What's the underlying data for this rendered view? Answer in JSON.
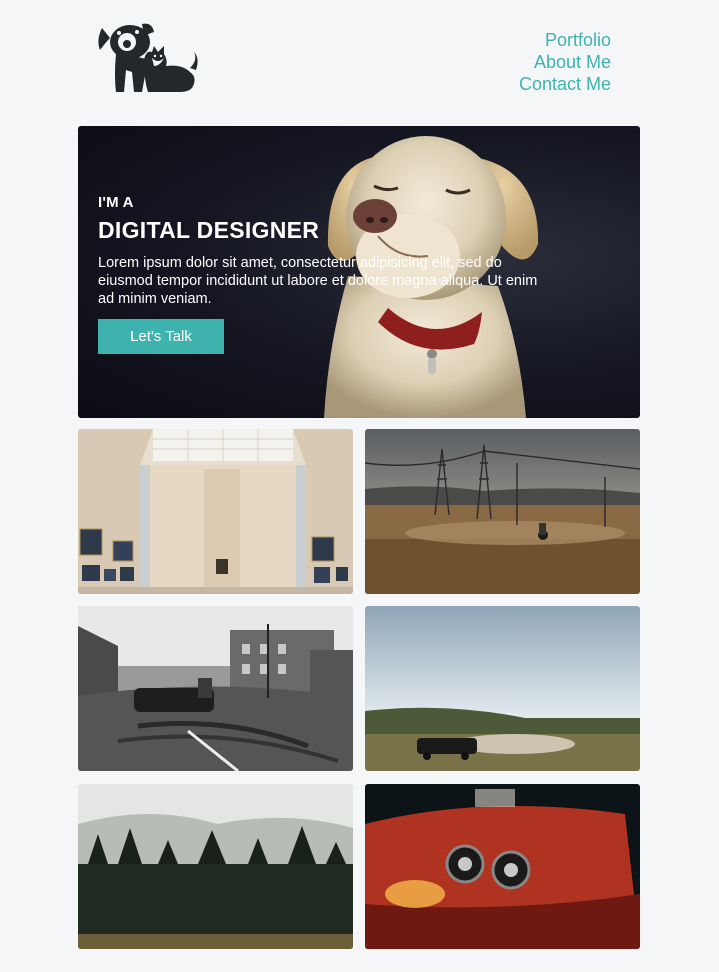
{
  "header": {
    "logo_icon": "dog-and-cat-logo",
    "nav": [
      "Portfolio",
      "About Me",
      "Contact Me"
    ]
  },
  "hero": {
    "kicker": "I'M A",
    "headline": "DIGITAL DESIGNER",
    "description": "Lorem ipsum dolor sit amet, consectetur adipisicing elit, sed do eiusmod tempor incididunt ut labore et dolore magna aliqua. Ut enim ad minim veniam.",
    "cta_label": "Let's Talk",
    "image": "labrador-dog-photo"
  },
  "gallery": [
    "museum-gallery-photo",
    "motorcycle-power-lines-photo",
    "street-drift-bw-photo",
    "car-drifting-field-photo",
    "foggy-forest-photo",
    "red-car-headlight-photo"
  ],
  "colors": {
    "accent": "#3eb3ad",
    "background": "#f5f6f8",
    "logo": "#23282b",
    "hero_bg": "#141521"
  }
}
